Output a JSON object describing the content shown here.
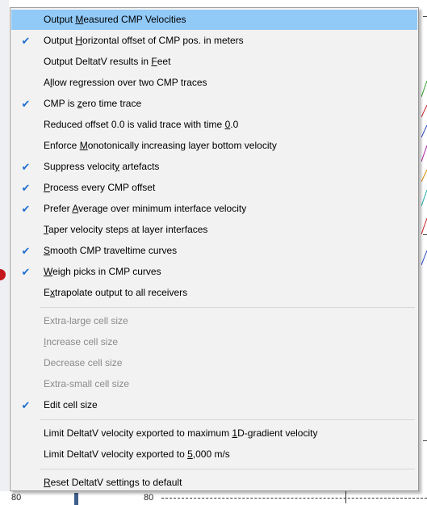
{
  "background": {
    "left_axis_value": "80",
    "mid_axis_value": "80"
  },
  "menu": {
    "accent_check_color": "#1f6fcf",
    "hover_color": "#91c9f7",
    "groups": [
      [
        {
          "pre": "Output ",
          "u": "M",
          "post": "easured CMP Velocities",
          "checked": false,
          "enabled": true,
          "hover": true
        },
        {
          "pre": "Output ",
          "u": "H",
          "post": "orizontal offset of CMP pos. in meters",
          "checked": true,
          "enabled": true
        },
        {
          "pre": "Output DeltatV results in ",
          "u": "F",
          "post": "eet",
          "checked": false,
          "enabled": true
        },
        {
          "pre": "A",
          "u": "l",
          "post": "low regression over two CMP traces",
          "checked": false,
          "enabled": true
        },
        {
          "pre": "CMP is ",
          "u": "z",
          "post": "ero time trace",
          "checked": true,
          "enabled": true
        },
        {
          "pre": "Reduced offset 0.0 is valid trace with time ",
          "u": "0",
          "post": ".0",
          "checked": false,
          "enabled": true
        },
        {
          "pre": "Enforce ",
          "u": "M",
          "post": "onotonically increasing layer bottom velocity",
          "checked": false,
          "enabled": true
        },
        {
          "pre": "Suppress velocit",
          "u": "y",
          "post": " artefacts",
          "checked": true,
          "enabled": true
        },
        {
          "pre": "",
          "u": "P",
          "post": "rocess every CMP offset",
          "checked": true,
          "enabled": true
        },
        {
          "pre": "Prefer ",
          "u": "A",
          "post": "verage over minimum interface velocity",
          "checked": true,
          "enabled": true
        },
        {
          "pre": "",
          "u": "T",
          "post": "aper velocity steps at layer interfaces",
          "checked": false,
          "enabled": true
        },
        {
          "pre": "",
          "u": "S",
          "post": "mooth CMP traveltime curves",
          "checked": true,
          "enabled": true
        },
        {
          "pre": "",
          "u": "W",
          "post": "eigh picks in CMP curves",
          "checked": true,
          "enabled": true
        },
        {
          "pre": "E",
          "u": "x",
          "post": "trapolate output to all receivers",
          "checked": false,
          "enabled": true
        }
      ],
      [
        {
          "pre": "Extra-large cell size",
          "u": "",
          "post": "",
          "checked": false,
          "enabled": false
        },
        {
          "pre": "",
          "u": "I",
          "post": "ncrease cell size",
          "checked": false,
          "enabled": false
        },
        {
          "pre": "Decrease cell size",
          "u": "",
          "post": "",
          "checked": false,
          "enabled": false
        },
        {
          "pre": "Extra-small cell size",
          "u": "",
          "post": "",
          "checked": false,
          "enabled": false
        },
        {
          "pre": "Edit cell size",
          "u": "",
          "post": "",
          "checked": true,
          "enabled": true
        }
      ],
      [
        {
          "pre": "Limit DeltatV velocity exported to maximum ",
          "u": "1",
          "post": "D-gradient velocity",
          "checked": false,
          "enabled": true
        },
        {
          "pre": "Limit DeltatV velocity exported to ",
          "u": "5",
          "post": ",000 m/s",
          "checked": false,
          "enabled": true
        }
      ],
      [
        {
          "pre": "",
          "u": "R",
          "post": "eset DeltatV settings to default",
          "checked": false,
          "enabled": true
        }
      ]
    ]
  }
}
